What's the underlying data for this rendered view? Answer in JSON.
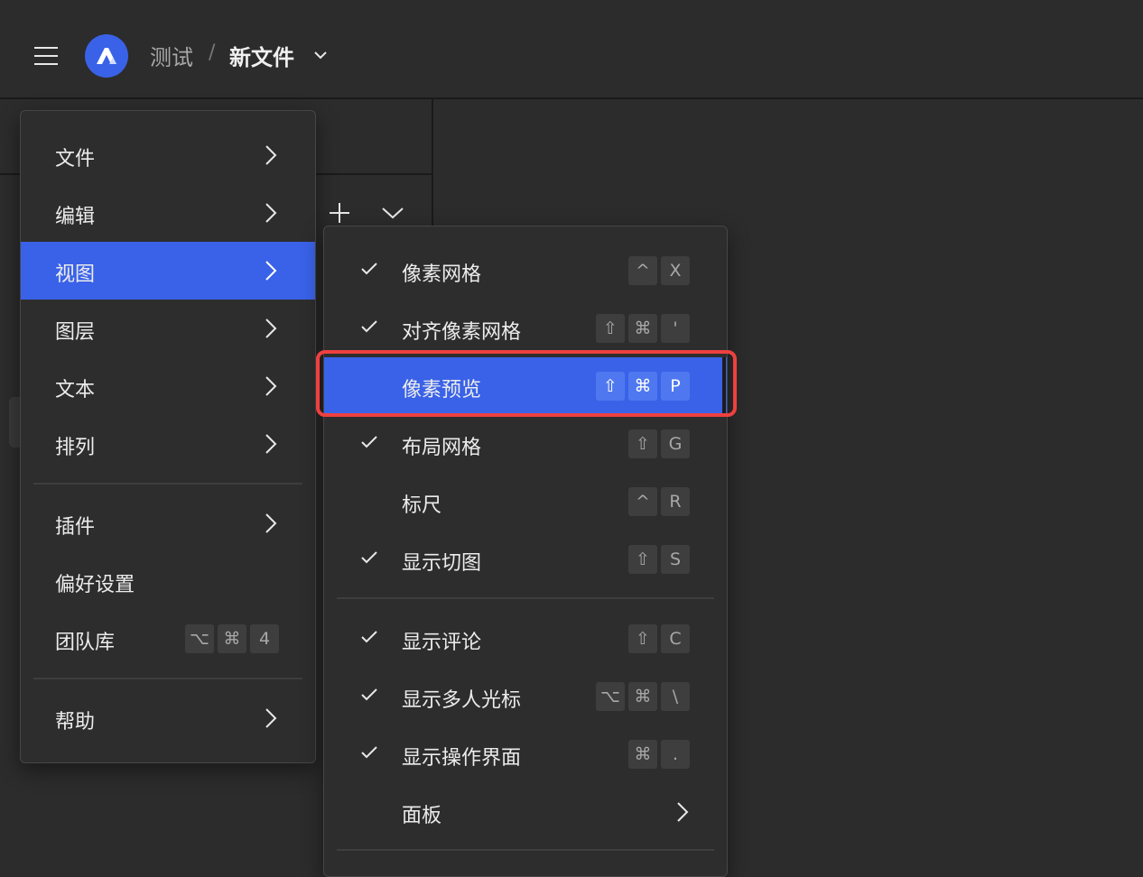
{
  "header": {
    "breadcrumb_parent": "测试",
    "breadcrumb_separator": "/",
    "breadcrumb_current": "新文件"
  },
  "main_menu": {
    "items": [
      {
        "label": "文件"
      },
      {
        "label": "编辑"
      },
      {
        "label": "视图"
      },
      {
        "label": "图层"
      },
      {
        "label": "文本"
      },
      {
        "label": "排列"
      },
      {
        "label": "插件"
      },
      {
        "label": "偏好设置"
      },
      {
        "label": "团队库",
        "keys": [
          "⌥",
          "⌘",
          "4"
        ]
      },
      {
        "label": "帮助"
      }
    ]
  },
  "view_submenu": {
    "items": [
      {
        "label": "像素网格",
        "keys": [
          "^",
          "X"
        ]
      },
      {
        "label": "对齐像素网格",
        "keys": [
          "⇧",
          "⌘",
          "'"
        ]
      },
      {
        "label": "像素预览",
        "keys": [
          "⇧",
          "⌘",
          "P"
        ]
      },
      {
        "label": "布局网格",
        "keys": [
          "⇧",
          "G"
        ]
      },
      {
        "label": "标尺",
        "keys": [
          "^",
          "R"
        ]
      },
      {
        "label": "显示切图",
        "keys": [
          "⇧",
          "S"
        ]
      },
      {
        "label": "显示评论",
        "keys": [
          "⇧",
          "C"
        ]
      },
      {
        "label": "显示多人光标",
        "keys": [
          "⌥",
          "⌘",
          "\\"
        ]
      },
      {
        "label": "显示操作界面",
        "keys": [
          "⌘",
          "."
        ]
      },
      {
        "label": "面板"
      }
    ]
  },
  "colors": {
    "accent": "#3a62e8",
    "highlight_outline": "#ee4040",
    "background": "#2c2c2c"
  }
}
